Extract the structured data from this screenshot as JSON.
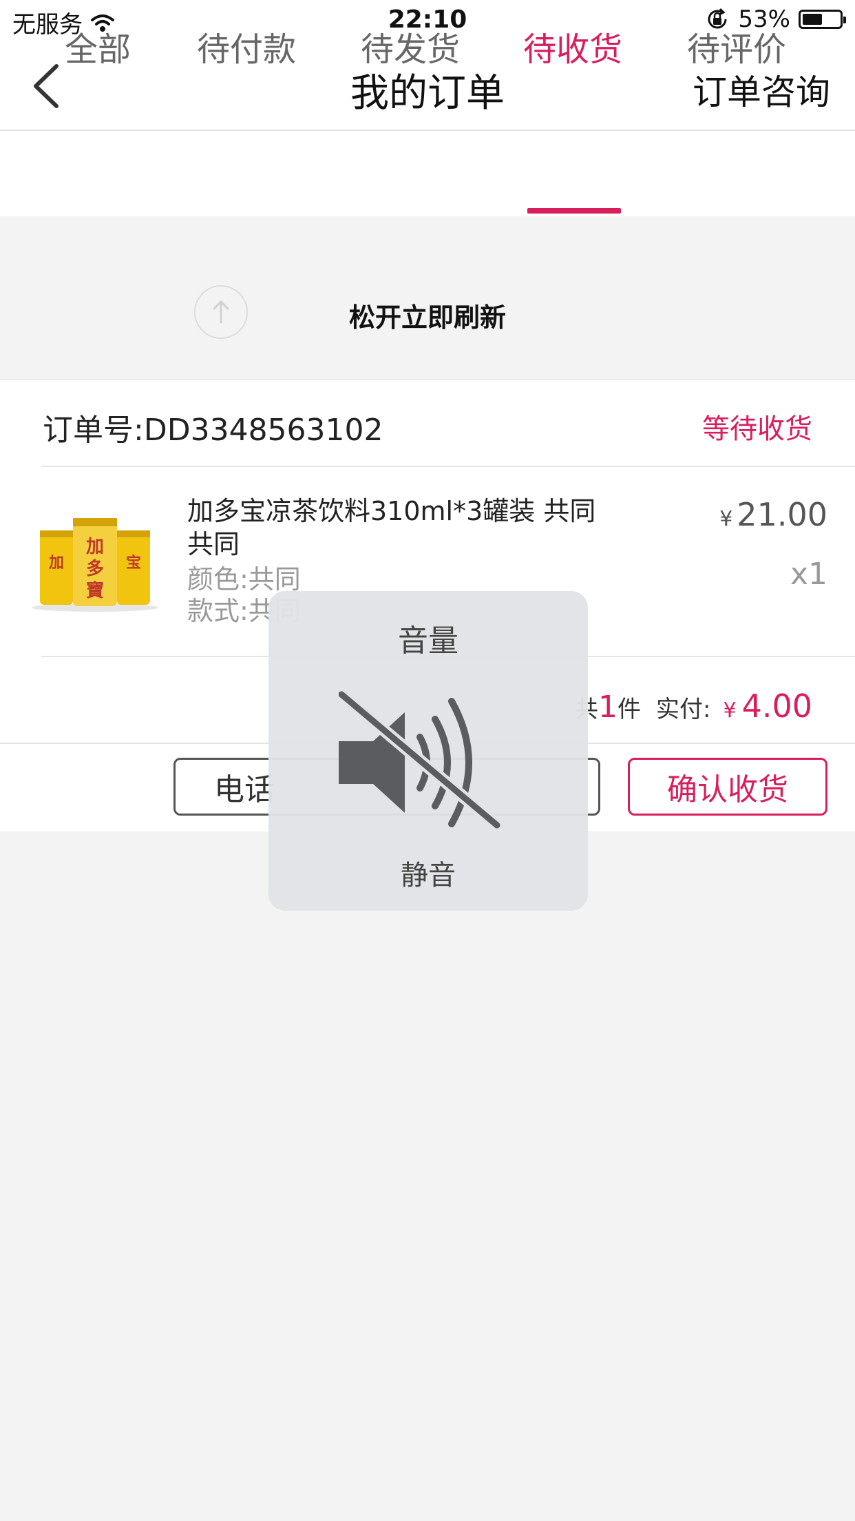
{
  "status_bar": {
    "carrier": "无服务",
    "time": "22:10",
    "battery_percent": "53%",
    "battery_level": 0.53
  },
  "nav": {
    "title": "我的订单",
    "right_action": "订单咨询"
  },
  "tabs": [
    {
      "label": "全部",
      "active": false
    },
    {
      "label": "待付款",
      "active": false
    },
    {
      "label": "待发货",
      "active": false
    },
    {
      "label": "待收货",
      "active": true
    },
    {
      "label": "待评价",
      "active": false
    }
  ],
  "refresh": {
    "text": "松开立即刷新"
  },
  "order": {
    "order_number": "订单号:DD3348563102",
    "status": "等待收货",
    "product": {
      "name": "加多宝凉茶饮料310ml*3罐装  共同 共同",
      "attr_color": "颜色:共同",
      "attr_style": "款式:共同",
      "currency": "¥",
      "price": "21.00",
      "quantity": "x1"
    },
    "summary": {
      "prefix": "共",
      "count": "1",
      "unit": "件",
      "paid_label": "实付:",
      "currency": "¥",
      "amount": "4.00"
    },
    "buttons": {
      "call": "电话",
      "confirm": "确认收货"
    }
  },
  "volume_hud": {
    "title": "音量",
    "state": "静音",
    "icon": "speaker-muted-icon"
  },
  "colors": {
    "accent": "#d81e5b",
    "background": "#f3f3f3"
  }
}
